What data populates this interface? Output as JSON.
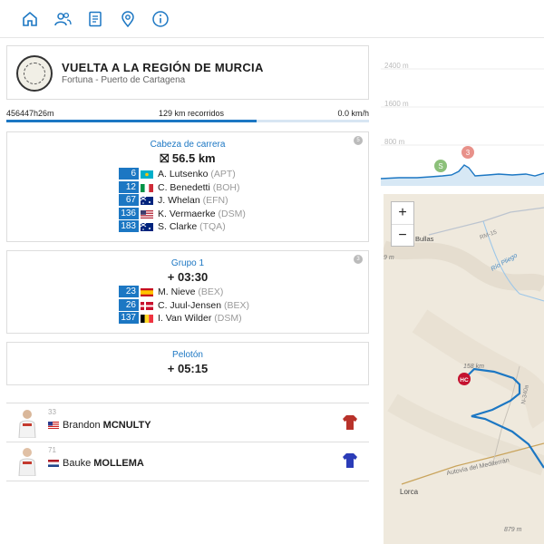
{
  "nav": {
    "icons": [
      "home-icon",
      "users-icon",
      "document-icon",
      "location-pin-icon",
      "info-icon"
    ]
  },
  "race": {
    "title": "VUELTA A LA REGIÓN DE MURCIA",
    "subtitle": "Fortuna - Puerto de Cartagena"
  },
  "progress": {
    "time": "456447h26m",
    "distance": "129 km recorridos",
    "speed": "0.0 km/h",
    "fraction": 0.69
  },
  "groups": [
    {
      "title": "Cabeza de carrera",
      "gap": "56.5 km",
      "badge": "5",
      "riders": [
        {
          "bib": "6",
          "name": "A. Lutsenko",
          "team": "(APT)",
          "flag": "kz"
        },
        {
          "bib": "12",
          "name": "C. Benedetti",
          "team": "(BOH)",
          "flag": "it"
        },
        {
          "bib": "67",
          "name": "J. Whelan",
          "team": "(EFN)",
          "flag": "au"
        },
        {
          "bib": "136",
          "name": "K. Vermaerke",
          "team": "(DSM)",
          "flag": "us"
        },
        {
          "bib": "183",
          "name": "S. Clarke",
          "team": "(TQA)",
          "flag": "au"
        }
      ]
    },
    {
      "title": "Grupo 1",
      "gap": "+ 03:30",
      "badge": "3",
      "riders": [
        {
          "bib": "23",
          "name": "M. Nieve",
          "team": "(BEX)",
          "flag": "es"
        },
        {
          "bib": "26",
          "name": "C. Juul-Jensen",
          "team": "(BEX)",
          "flag": "dk"
        },
        {
          "bib": "137",
          "name": "I. Van Wilder",
          "team": "(DSM)",
          "flag": "be"
        }
      ]
    },
    {
      "title": "Pelotón",
      "gap": "+ 05:15"
    }
  ],
  "cards": [
    {
      "number": "33",
      "first": "Brandon",
      "last": "MCNULTY",
      "flag": "us",
      "jersey_color": "#b8322a"
    },
    {
      "number": "71",
      "first": "Bauke",
      "last": "MOLLEMA",
      "flag": "nl",
      "jersey_color": "#2b3cb8"
    }
  ],
  "profile": {
    "y_labels": [
      "2400 m",
      "1600 m",
      "800 m"
    ],
    "markers": [
      {
        "label": "S",
        "color": "#8cc07a"
      },
      {
        "label": "3",
        "color": "#e8918a"
      }
    ]
  },
  "map": {
    "zoom_in": "+",
    "zoom_out": "−",
    "labels": {
      "bullas": "Bullas",
      "rm15": "RM-15",
      "rio": "Río Pliego",
      "km158": "158 km",
      "n340": "N-340a",
      "autovia": "Autovía del Mediterrán",
      "lorca": "Lorca",
      "alt879": "879 m",
      "hc": "HC",
      "edge": "9 m"
    }
  }
}
